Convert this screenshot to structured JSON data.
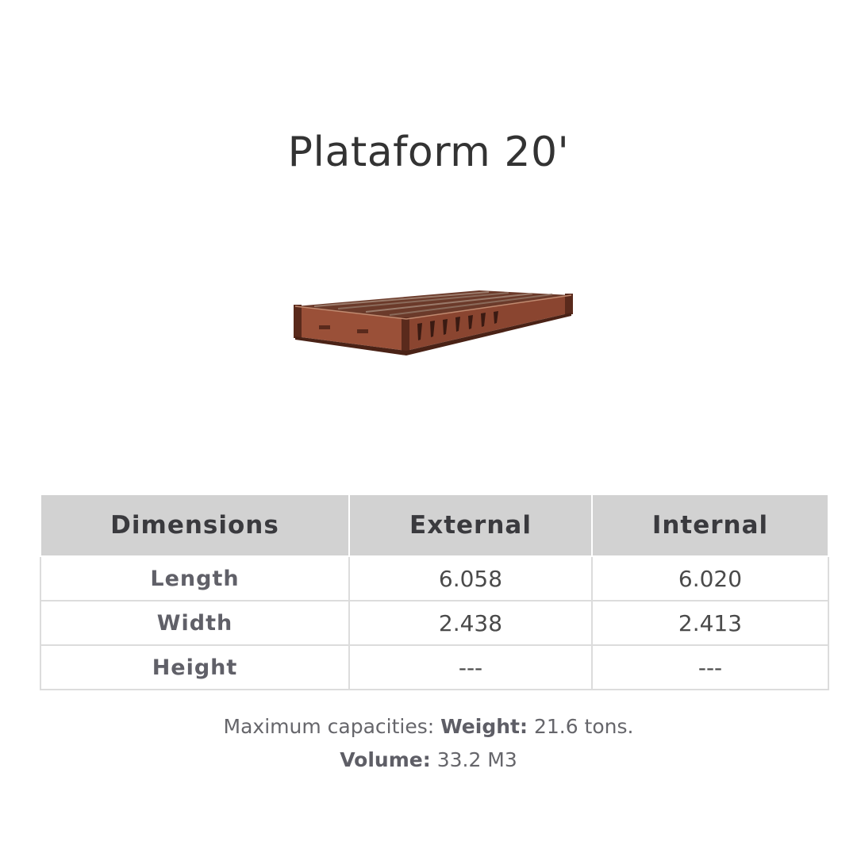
{
  "title": "Plataform 20'",
  "table": {
    "headers": [
      "Dimensions",
      "External",
      "Internal"
    ],
    "rows": [
      {
        "label": "Length",
        "external": "6.058",
        "internal": "6.020"
      },
      {
        "label": "Width",
        "external": "2.438",
        "internal": "2.413"
      },
      {
        "label": "Height",
        "external": "---",
        "internal": "---"
      }
    ]
  },
  "capacities": {
    "prefix": "Maximum capacities:",
    "weight_label": "Weight:",
    "weight_value": "21.6 tons.",
    "volume_label": "Volume:",
    "volume_value": "33.2 M3"
  },
  "image": {
    "icon": "flat-rack-container-icon",
    "color": "#7a3a24"
  }
}
